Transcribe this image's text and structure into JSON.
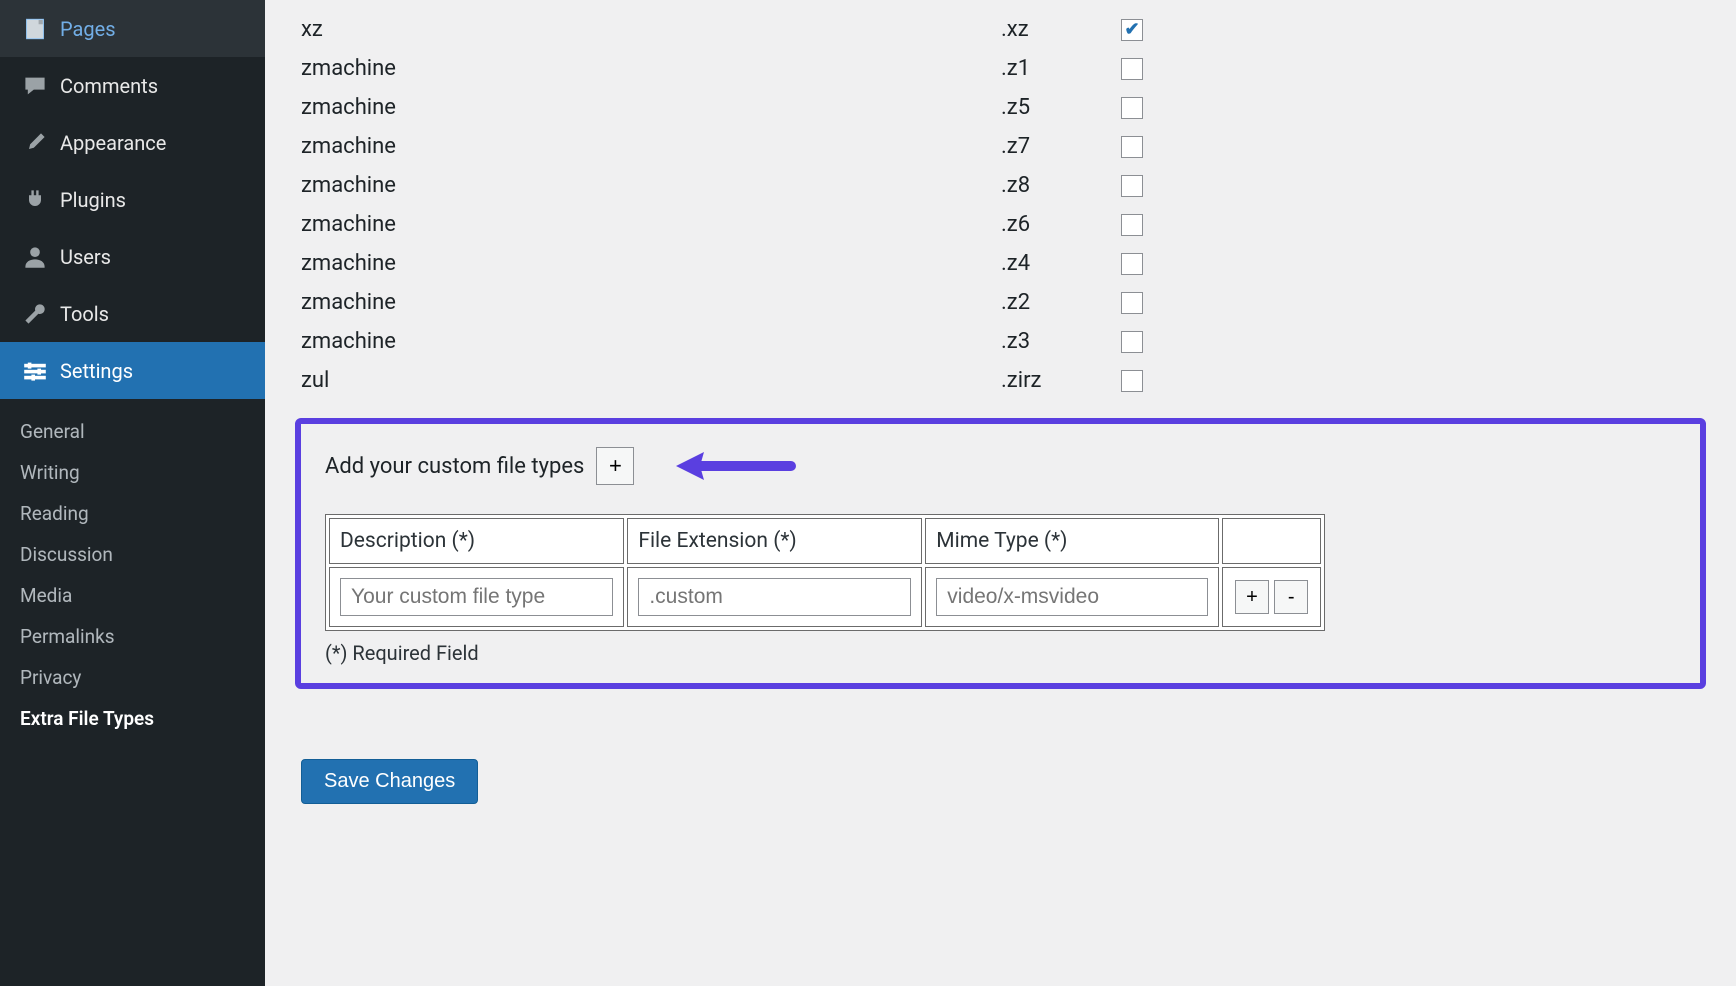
{
  "sidebar": {
    "items": [
      {
        "id": "pages",
        "label": "Pages"
      },
      {
        "id": "comments",
        "label": "Comments"
      },
      {
        "id": "appearance",
        "label": "Appearance"
      },
      {
        "id": "plugins",
        "label": "Plugins"
      },
      {
        "id": "users",
        "label": "Users"
      },
      {
        "id": "tools",
        "label": "Tools"
      },
      {
        "id": "settings",
        "label": "Settings"
      }
    ],
    "settings_sub": [
      {
        "id": "general",
        "label": "General"
      },
      {
        "id": "writing",
        "label": "Writing"
      },
      {
        "id": "reading",
        "label": "Reading"
      },
      {
        "id": "discussion",
        "label": "Discussion"
      },
      {
        "id": "media",
        "label": "Media"
      },
      {
        "id": "permalinks",
        "label": "Permalinks"
      },
      {
        "id": "privacy",
        "label": "Privacy"
      },
      {
        "id": "extra-file-types",
        "label": "Extra File Types",
        "current": true
      }
    ]
  },
  "custom_section": {
    "heading": "Add your custom file types",
    "plus_label": "+",
    "table_headers": {
      "description": "Description (*)",
      "extension": "File Extension (*)",
      "mime": "Mime Type (*)"
    },
    "row": {
      "description_placeholder": "Your custom file type",
      "extension_placeholder": ".custom",
      "mime_placeholder": "video/x-msvideo",
      "add_label": "+",
      "remove_label": "-"
    },
    "required_note": "(*) Required Field"
  },
  "save_label": "Save Changes",
  "file_rows": [
    {
      "name": "xz",
      "ext": ".xz",
      "checked": true
    },
    {
      "name": "zmachine",
      "ext": ".z1",
      "checked": false
    },
    {
      "name": "zmachine",
      "ext": ".z5",
      "checked": false
    },
    {
      "name": "zmachine",
      "ext": ".z7",
      "checked": false
    },
    {
      "name": "zmachine",
      "ext": ".z8",
      "checked": false
    },
    {
      "name": "zmachine",
      "ext": ".z6",
      "checked": false
    },
    {
      "name": "zmachine",
      "ext": ".z4",
      "checked": false
    },
    {
      "name": "zmachine",
      "ext": ".z2",
      "checked": false
    },
    {
      "name": "zmachine",
      "ext": ".z3",
      "checked": false
    },
    {
      "name": "zul",
      "ext": ".zirz",
      "checked": false
    }
  ]
}
